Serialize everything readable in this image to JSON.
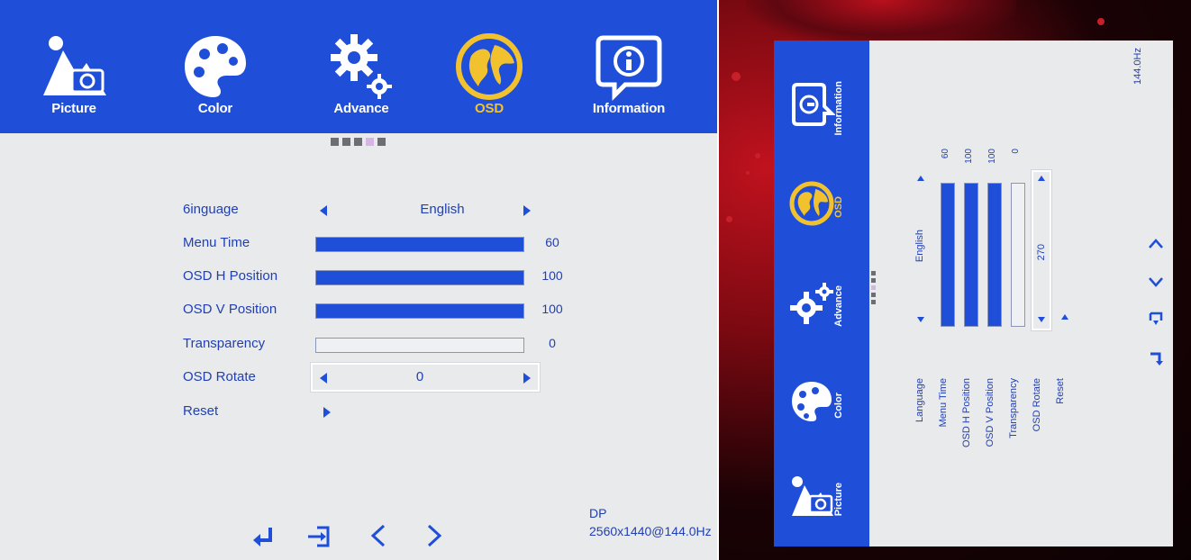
{
  "left_osd": {
    "tabs": [
      {
        "label": "Picture",
        "icon": "picture-icon"
      },
      {
        "label": "Color",
        "icon": "palette-icon"
      },
      {
        "label": "Advance",
        "icon": "gear-icon"
      },
      {
        "label": "OSD",
        "icon": "globe-icon",
        "active": true
      },
      {
        "label": "Information",
        "icon": "info-icon"
      }
    ],
    "rows": {
      "language": {
        "label": "6inguage",
        "value": "English"
      },
      "menu_time": {
        "label": "Menu Time",
        "value": "60",
        "level": 1.0
      },
      "osd_h": {
        "label": "OSD H Position",
        "value": "100",
        "level": 1.0
      },
      "osd_v": {
        "label": "OSD V Position",
        "value": "100",
        "level": 1.0
      },
      "transparency": {
        "label": "Transparency",
        "value": "0",
        "level": 0.0
      },
      "osd_rotate": {
        "label": "OSD Rotate",
        "value": "0"
      },
      "reset": {
        "label": "Reset"
      }
    },
    "bottom_icons": [
      "enter-icon",
      "exit-icon",
      "left-chevron-icon",
      "right-chevron-icon"
    ],
    "signal": {
      "input": "DP",
      "mode": "2560x1440@144.0Hz"
    }
  },
  "right_osd": {
    "tabs": [
      {
        "label": "Picture"
      },
      {
        "label": "Color"
      },
      {
        "label": "Advance"
      },
      {
        "label": "OSD",
        "active": true
      },
      {
        "label": "Information"
      }
    ],
    "rows": {
      "language": {
        "label": "Language",
        "value": "English"
      },
      "menu_time": {
        "label": "Menu Time",
        "value": "60",
        "level": 1.0
      },
      "osd_h": {
        "label": "OSD H Position",
        "value": "100",
        "level": 1.0
      },
      "osd_v": {
        "label": "OSD V Position",
        "value": "100",
        "level": 1.0
      },
      "transparency": {
        "label": "Transparency",
        "value": "0",
        "level": 0.0
      },
      "osd_rotate": {
        "label": "OSD Rotate",
        "value": "270"
      },
      "reset": {
        "label": "Reset"
      }
    },
    "refresh": "144.0Hz"
  },
  "colors": {
    "menu_blue": "#1f4fd8",
    "active_yellow": "#f2c22e",
    "panel_gray": "#e9eaec",
    "text_blue": "#203fb3"
  }
}
